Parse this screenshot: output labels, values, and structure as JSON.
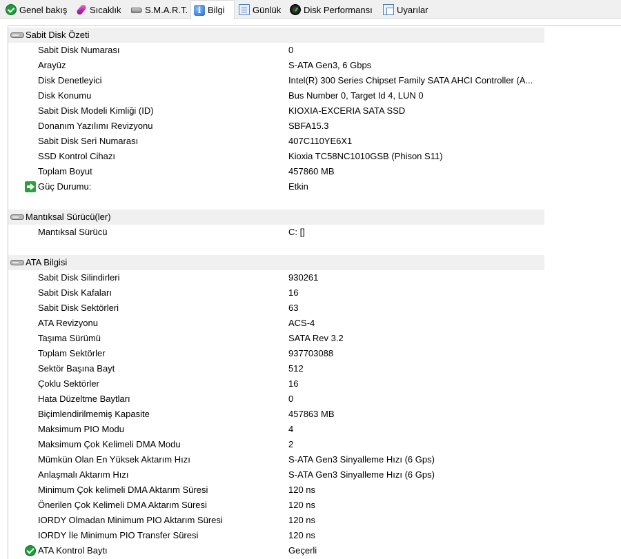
{
  "tabs": [
    {
      "label": "Genel bakış",
      "icon": "check-circle-icon"
    },
    {
      "label": "Sıcaklık",
      "icon": "thermometer-icon"
    },
    {
      "label": "S.M.A.R.T.",
      "icon": "hard-disk-icon"
    },
    {
      "label": "Bilgi",
      "icon": "info-icon",
      "active": true
    },
    {
      "label": "Günlük",
      "icon": "document-icon"
    },
    {
      "label": "Disk Performansı",
      "icon": "gauge-icon"
    },
    {
      "label": "Uyarılar",
      "icon": "pages-icon"
    }
  ],
  "sections": [
    {
      "title": "Sabit Disk Özeti",
      "rows": [
        {
          "label": "Sabit Disk Numarası",
          "value": "0"
        },
        {
          "label": "Arayüz",
          "value": "S-ATA Gen3, 6 Gbps"
        },
        {
          "label": "Disk Denetleyici",
          "value": "Intel(R) 300 Series Chipset Family SATA AHCI Controller (A..."
        },
        {
          "label": "Disk Konumu",
          "value": "Bus Number 0, Target Id 4, LUN 0"
        },
        {
          "label": "Sabit Disk Modeli Kimliği (ID)",
          "value": "KIOXIA-EXCERIA SATA SSD"
        },
        {
          "label": "Donanım Yazılımı Revizyonu",
          "value": "SBFA15.3"
        },
        {
          "label": "Sabit Disk Seri Numarası",
          "value": "407C110YE6X1"
        },
        {
          "label": "SSD Kontrol Cihazı",
          "value": "Kioxia TC58NC1010GSB (Phison S11)"
        },
        {
          "label": "Toplam Boyut",
          "value": "457860 MB"
        },
        {
          "label": "Güç Durumu:",
          "value": "Etkin",
          "icon": "green-arrow-icon"
        }
      ]
    },
    {
      "title": "Mantıksal Sürücü(ler)",
      "rows": [
        {
          "label": "Mantıksal Sürücü",
          "value": "C: []"
        }
      ]
    },
    {
      "title": "ATA Bilgisi",
      "rows": [
        {
          "label": "Sabit Disk Silindirleri",
          "value": "930261"
        },
        {
          "label": "Sabit Disk Kafaları",
          "value": "16"
        },
        {
          "label": "Sabit Disk Sektörleri",
          "value": "63"
        },
        {
          "label": "ATA Revizyonu",
          "value": "ACS-4"
        },
        {
          "label": "Taşıma Sürümü",
          "value": "SATA Rev 3.2"
        },
        {
          "label": "Toplam Sektörler",
          "value": "937703088"
        },
        {
          "label": "Sektör Başına Bayt",
          "value": "512"
        },
        {
          "label": "Çoklu Sektörler",
          "value": "16"
        },
        {
          "label": "Hata Düzeltme Baytları",
          "value": "0"
        },
        {
          "label": "Biçimlendirilmemiş Kapasite",
          "value": "457863 MB"
        },
        {
          "label": "Maksimum PIO Modu",
          "value": "4"
        },
        {
          "label": "Maksimum Çok Kelimeli DMA Modu",
          "value": "2"
        },
        {
          "label": "Mümkün Olan En Yüksek Aktarım Hızı",
          "value": "S-ATA Gen3 Sinyalleme Hızı (6 Gps)"
        },
        {
          "label": "Anlaşmalı Aktarım Hızı",
          "value": "S-ATA Gen3 Sinyalleme Hızı (6 Gps)"
        },
        {
          "label": "Minimum Çok kelimeli DMA Aktarım Süresi",
          "value": "120 ns"
        },
        {
          "label": "Önerilen Çok Kelimeli DMA Aktarım Süresi",
          "value": "120 ns"
        },
        {
          "label": "IORDY Olmadan Minimum PIO Aktarım Süresi",
          "value": "120 ns"
        },
        {
          "label": "IORDY İle Minimum PIO Transfer Süresi",
          "value": "120 ns"
        },
        {
          "label": "ATA Kontrol Baytı",
          "value": "Geçerli",
          "icon": "green-check-icon"
        }
      ]
    }
  ]
}
